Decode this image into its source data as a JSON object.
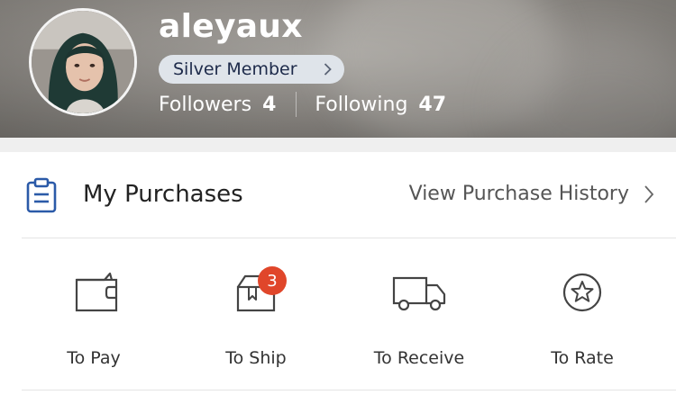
{
  "profile": {
    "username": "aleyaux",
    "membership": "Silver Member",
    "followers_label": "Followers",
    "followers_count": "4",
    "following_label": "Following",
    "following_count": "47"
  },
  "purchases": {
    "title": "My Purchases",
    "history_link": "View Purchase History",
    "statuses": [
      {
        "label": "To Pay",
        "icon": "wallet-icon"
      },
      {
        "label": "To Ship",
        "icon": "package-icon",
        "badge": "3"
      },
      {
        "label": "To Receive",
        "icon": "truck-icon"
      },
      {
        "label": "To Rate",
        "icon": "star-circle-icon"
      }
    ]
  },
  "colors": {
    "accent": "#2b5aa8",
    "badge": "#e0462a",
    "member_badge_bg": "#dfe4ea"
  }
}
